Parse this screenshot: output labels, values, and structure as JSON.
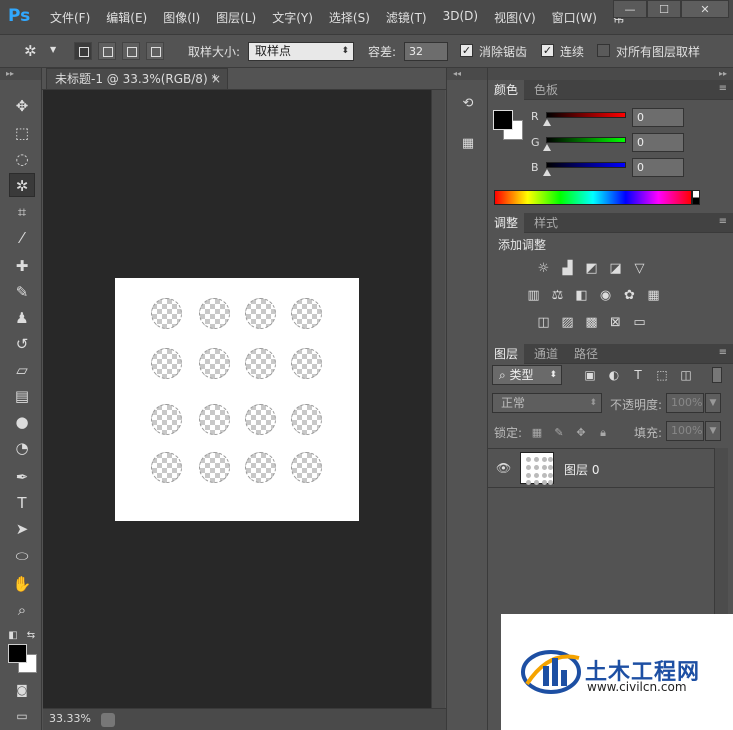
{
  "app": {
    "logo": "Ps"
  },
  "menu": [
    "文件(F)",
    "编辑(E)",
    "图像(I)",
    "图层(L)",
    "文字(Y)",
    "选择(S)",
    "滤镜(T)",
    "3D(D)",
    "视图(V)",
    "窗口(W)",
    "帮"
  ],
  "window_controls": {
    "minimize": "—",
    "maximize": "☐",
    "close": "✕"
  },
  "options": {
    "sample_size_label": "取样大小:",
    "sample_size_value": "取样点",
    "tolerance_label": "容差:",
    "tolerance_value": "32",
    "anti_alias_label": "消除锯齿",
    "anti_alias_checked": true,
    "contiguous_label": "连续",
    "contiguous_checked": true,
    "all_layers_label": "对所有图层取样",
    "all_layers_checked": false
  },
  "document": {
    "tab_title": "未标题-1 @ 33.3%(RGB/8) *",
    "tab_close": "×",
    "zoom": "33.33%"
  },
  "tools": [
    {
      "name": "move-tool-icon",
      "glyph": "✥"
    },
    {
      "name": "marquee-tool-icon",
      "glyph": "⬚"
    },
    {
      "name": "lasso-tool-icon",
      "glyph": "◌"
    },
    {
      "name": "magic-wand-tool-icon",
      "glyph": "✲",
      "active": true
    },
    {
      "name": "crop-tool-icon",
      "glyph": "⌗"
    },
    {
      "name": "eyedropper-tool-icon",
      "glyph": "⁄"
    },
    {
      "name": "healing-brush-tool-icon",
      "glyph": "✚"
    },
    {
      "name": "brush-tool-icon",
      "glyph": "✎"
    },
    {
      "name": "stamp-tool-icon",
      "glyph": "♟"
    },
    {
      "name": "history-brush-tool-icon",
      "glyph": "↺"
    },
    {
      "name": "eraser-tool-icon",
      "glyph": "▱"
    },
    {
      "name": "gradient-tool-icon",
      "glyph": "▤"
    },
    {
      "name": "blur-tool-icon",
      "glyph": "●"
    },
    {
      "name": "dodge-tool-icon",
      "glyph": "◔"
    },
    {
      "name": "pen-tool-icon",
      "glyph": "✒"
    },
    {
      "name": "type-tool-icon",
      "glyph": "T"
    },
    {
      "name": "path-selection-tool-icon",
      "glyph": "➤"
    },
    {
      "name": "ellipse-tool-icon",
      "glyph": "⬭"
    },
    {
      "name": "hand-tool-icon",
      "glyph": "✋"
    },
    {
      "name": "zoom-tool-icon",
      "glyph": "⌕"
    }
  ],
  "panels": {
    "color_tabs": [
      "颜色",
      "色板"
    ],
    "color": {
      "r_label": "R",
      "r_value": "0",
      "g_label": "G",
      "g_value": "0",
      "b_label": "B",
      "b_value": "0"
    },
    "adjust_tabs": [
      "调整",
      "样式"
    ],
    "adjust_title": "添加调整",
    "layers_tabs": [
      "图层",
      "通道",
      "路径"
    ],
    "layers": {
      "kind_label": "类型",
      "blend_mode": "正常",
      "opacity_label": "不透明度:",
      "opacity_value": "100%",
      "lock_label": "锁定:",
      "fill_label": "填充:",
      "fill_value": "100%",
      "layer_name": "图层 0"
    }
  },
  "watermark": {
    "title": "土木工程网",
    "url": "www.civilcn.com"
  },
  "colors": {
    "accent_ps": "#31a8ff",
    "watermark_blue": "#1d4fa3"
  }
}
